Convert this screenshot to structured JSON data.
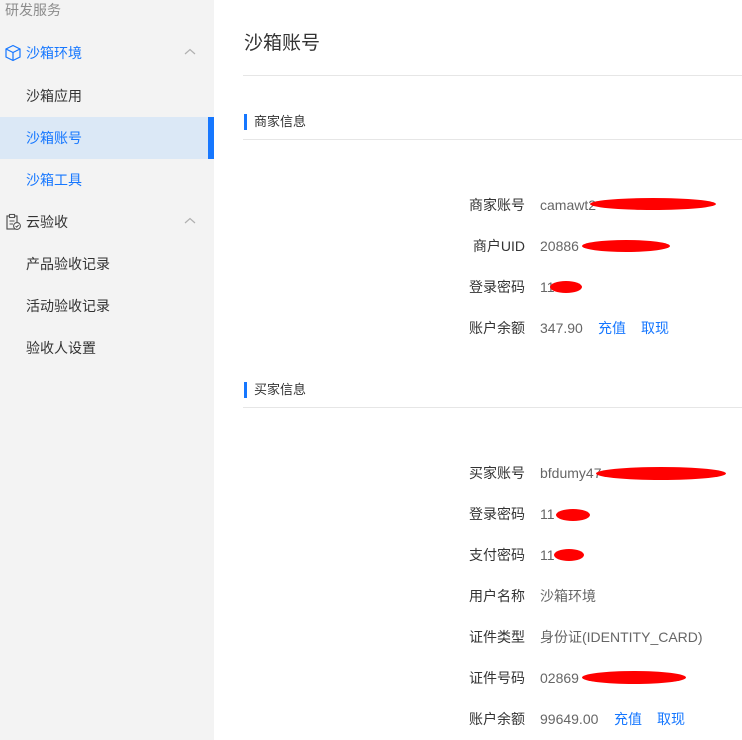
{
  "sidebar": {
    "top_label": "研发服务",
    "groups": [
      {
        "label": "沙箱环境",
        "icon": "cube-icon",
        "color": "#1677ff"
      },
      {
        "label": "云验收",
        "icon": "clipboard-check-icon",
        "color": "#333333"
      }
    ],
    "sandbox_items": [
      {
        "label": "沙箱应用"
      },
      {
        "label": "沙箱账号"
      },
      {
        "label": "沙箱工具"
      }
    ],
    "acceptance_items": [
      {
        "label": "产品验收记录"
      },
      {
        "label": "活动验收记录"
      },
      {
        "label": "验收人设置"
      }
    ]
  },
  "main": {
    "page_title": "沙箱账号",
    "merchant": {
      "section_title": "商家信息",
      "fields": [
        {
          "label": "商家账号",
          "value": "camawt2"
        },
        {
          "label": "商户UID",
          "value": "20886"
        },
        {
          "label": "登录密码",
          "value": "11"
        },
        {
          "label": "账户余额",
          "value": "347.90"
        }
      ],
      "recharge_label": "充值",
      "withdraw_label": "取现"
    },
    "buyer": {
      "section_title": "买家信息",
      "fields": [
        {
          "label": "买家账号",
          "value": "bfdumy47"
        },
        {
          "label": "登录密码",
          "value": "11"
        },
        {
          "label": "支付密码",
          "value": "11"
        },
        {
          "label": "用户名称",
          "value": "沙箱环境"
        },
        {
          "label": "证件类型",
          "value": "身份证(IDENTITY_CARD)"
        },
        {
          "label": "证件号码",
          "value": "02869"
        },
        {
          "label": "账户余额",
          "value": "99649.00"
        }
      ],
      "recharge_label": "充值",
      "withdraw_label": "取现"
    }
  },
  "colors": {
    "accent": "#1677ff",
    "active_bg": "#dbe8f6",
    "redaction": "#ff0000",
    "warning": "#e02020"
  }
}
